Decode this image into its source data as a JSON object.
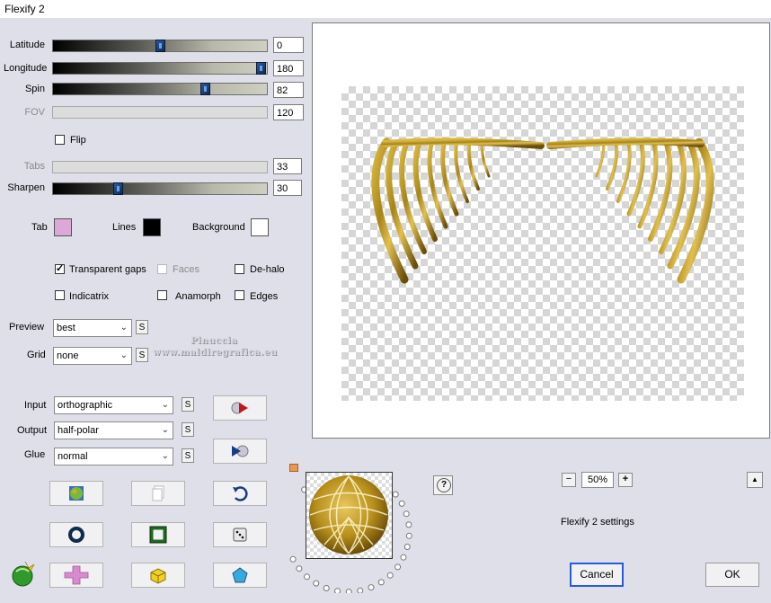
{
  "window": {
    "title": "Flexify 2"
  },
  "sliders": [
    {
      "label": "Latitude",
      "value": "0",
      "fraction": 0.5,
      "disabled": false
    },
    {
      "label": "Longitude",
      "value": "180",
      "fraction": 1.0,
      "disabled": false
    },
    {
      "label": "Spin",
      "value": "82",
      "fraction": 0.72,
      "disabled": false
    },
    {
      "label": "FOV",
      "value": "120",
      "disabled": true
    },
    {
      "label": "Tabs",
      "value": "33",
      "disabled": true
    },
    {
      "label": "Sharpen",
      "value": "30",
      "fraction": 0.3,
      "disabled": false
    }
  ],
  "flip": {
    "label": "Flip",
    "checked": false
  },
  "colors": {
    "tab": {
      "label": "Tab",
      "color": "#dca8d8"
    },
    "lines": {
      "label": "Lines",
      "color": "#000000"
    },
    "background": {
      "label": "Background",
      "color": "#ffffff"
    }
  },
  "options": {
    "transparent_gaps": {
      "label": "Transparent gaps",
      "checked": true
    },
    "faces": {
      "label": "Faces",
      "checked": false,
      "disabled": true
    },
    "de_halo": {
      "label": "De-halo",
      "checked": false
    },
    "indicatrix": {
      "label": "Indicatrix",
      "checked": false
    },
    "anamorph": {
      "label": "Anamorph",
      "checked": false
    },
    "edges": {
      "label": "Edges",
      "checked": false
    }
  },
  "selects": {
    "preview": {
      "label": "Preview",
      "value": "best"
    },
    "grid": {
      "label": "Grid",
      "value": "none"
    },
    "input": {
      "label": "Input",
      "value": "orthographic"
    },
    "output": {
      "label": "Output",
      "value": "half-polar"
    },
    "glue": {
      "label": "Glue",
      "value": "normal"
    }
  },
  "s_button_label": "S",
  "watermark": {
    "line1": "Pinuccia",
    "line2": "www.maldiregrafica.eu"
  },
  "zoom": {
    "value": "50%",
    "minus": "−",
    "plus": "+"
  },
  "help_label": "?",
  "settings_label": "Flexify 2 settings",
  "collapse_label": "▲",
  "cancel_label": "Cancel",
  "ok_label": "OK",
  "accent_colors": {
    "gold": "#b8901c",
    "dark_gold": "#6b4e08",
    "focus": "#2a5bd8"
  }
}
